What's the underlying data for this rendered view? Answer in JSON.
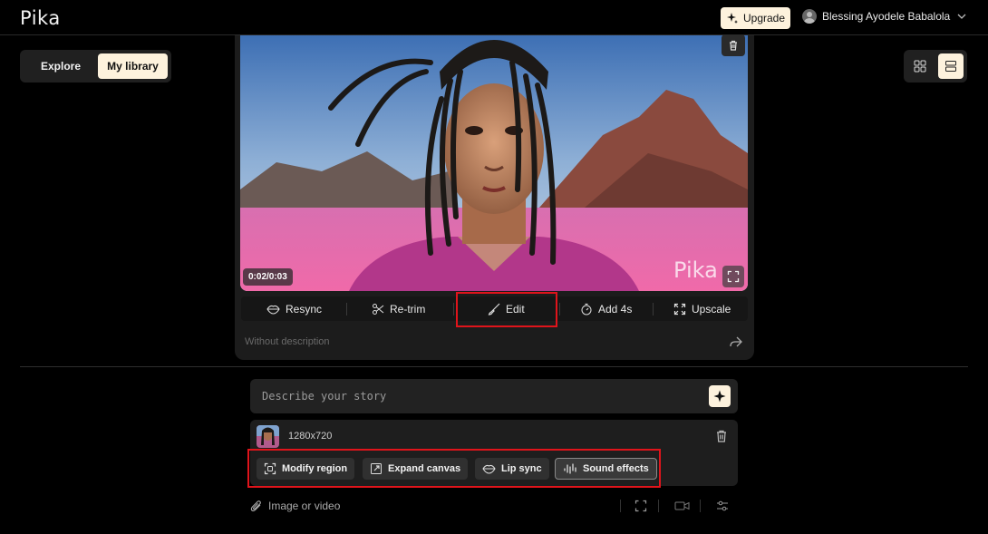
{
  "app": {
    "name": "Pika"
  },
  "header": {
    "upgrade_label": "Upgrade",
    "user_name": "Blessing Ayodele Babalola"
  },
  "nav": {
    "tabs": [
      {
        "label": "Explore",
        "active": false
      },
      {
        "label": "My library",
        "active": true
      }
    ]
  },
  "video": {
    "timecode": "0:02/0:03",
    "watermark": "Pika"
  },
  "actions": {
    "resync": "Resync",
    "retrim": "Re-trim",
    "edit": "Edit",
    "add4s": "Add 4s",
    "upscale": "Upscale"
  },
  "description": "Without description",
  "prompt": {
    "placeholder": "Describe your story"
  },
  "media": {
    "resolution": "1280x720",
    "chips": [
      {
        "label": "Modify region",
        "icon": "modify-region-icon"
      },
      {
        "label": "Expand canvas",
        "icon": "expand-canvas-icon"
      },
      {
        "label": "Lip sync",
        "icon": "lips-icon"
      },
      {
        "label": "Sound effects",
        "icon": "sound-effects-icon",
        "active": true
      }
    ]
  },
  "bottom": {
    "attach_label": "Image or video"
  },
  "colors": {
    "accent": "#fdf2dd",
    "highlight": "#e0141b",
    "background": "#000000"
  }
}
